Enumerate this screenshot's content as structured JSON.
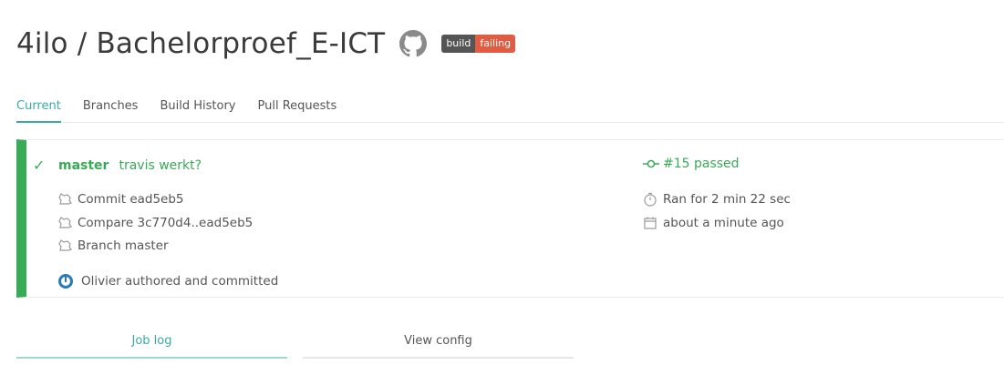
{
  "repo": {
    "title": "4ilo / Bachelorproef_E-ICT"
  },
  "badge": {
    "left": "build",
    "right": "failing"
  },
  "tabs": [
    "Current",
    "Branches",
    "Build History",
    "Pull Requests"
  ],
  "build": {
    "branch": "master",
    "message": "travis werkt?",
    "commit": "Commit ead5eb5",
    "compare": "Compare 3c770d4..ead5eb5",
    "branch_label": "Branch master",
    "author": "Olivier authored and committed",
    "status": "#15 passed",
    "duration": "Ran for 2 min 22 sec",
    "time_ago": "about a minute ago",
    "status_color": "#39aa56"
  },
  "bottom_tabs": {
    "job_log": "Job log",
    "view_config": "View config"
  }
}
